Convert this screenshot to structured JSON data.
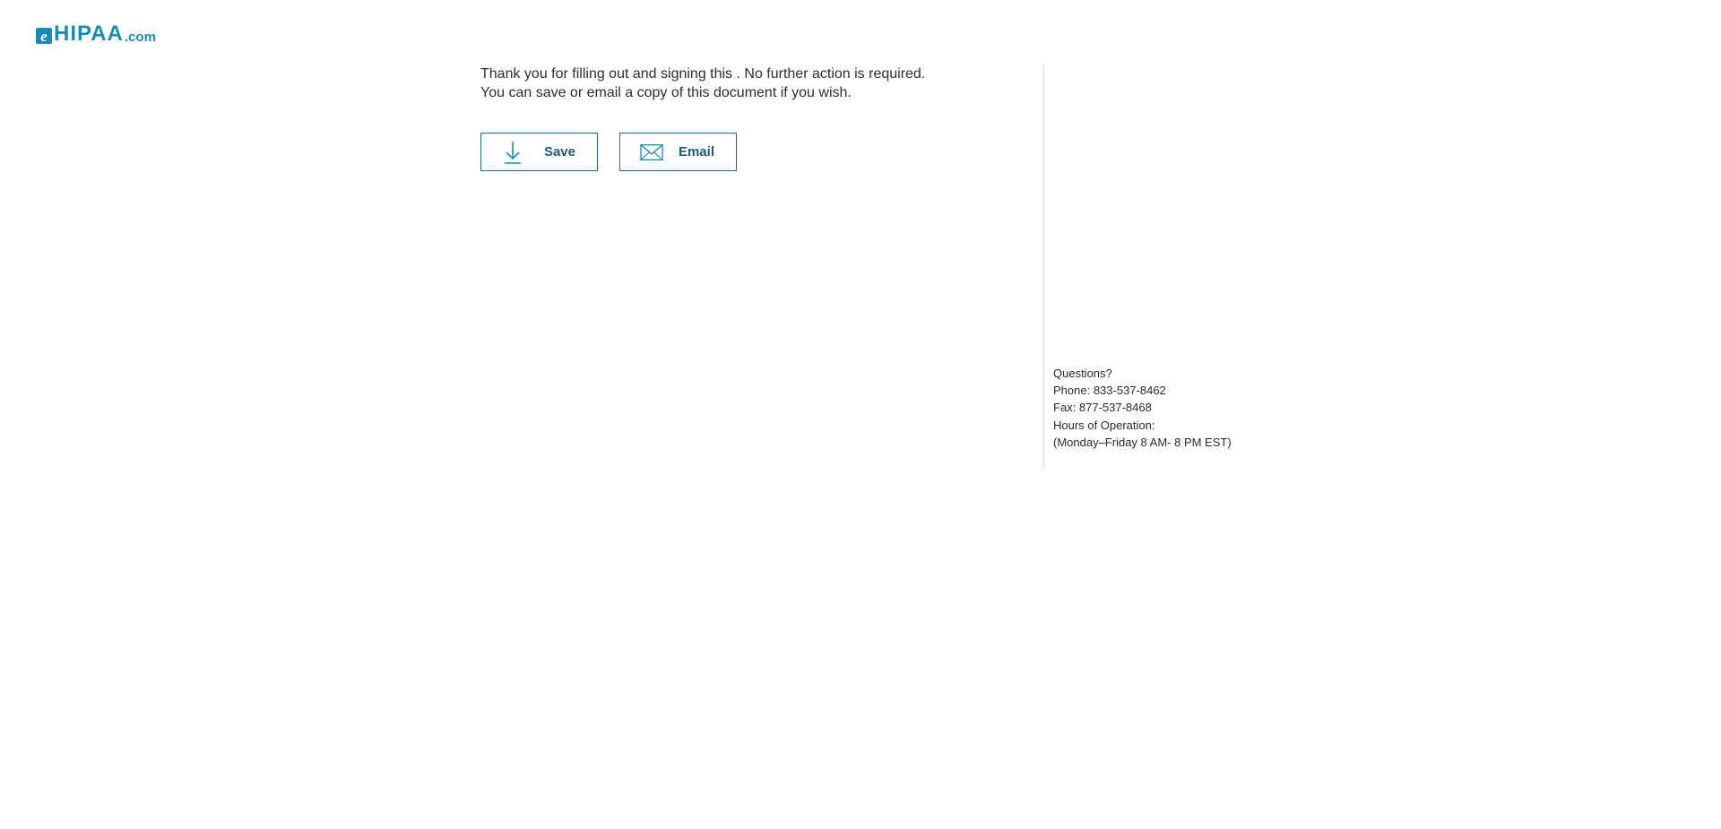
{
  "brand": {
    "logo_mark": "e",
    "logo_main": "HIPAA",
    "logo_suffix": ".com",
    "color": "#1b8bb1"
  },
  "main": {
    "message_line1": "Thank you for filling out and signing this . No further action is required.",
    "message_line2": "You can save or email a copy of this document if you wish.",
    "save_button": {
      "label": "Save",
      "icon": "download-icon"
    },
    "email_button": {
      "label": "Email",
      "icon": "envelope-icon"
    }
  },
  "contact": {
    "questions": "Questions?",
    "phone": "Phone: 833-537-8462",
    "fax": "Fax: 877-537-8468",
    "hours_label": "Hours of Operation:",
    "hours": "(Monday–Friday 8 AM- 8 PM EST)"
  },
  "colors": {
    "button_border": "#1f6f8b",
    "button_text": "#1f5a72",
    "divider": "#d9d9d9"
  }
}
